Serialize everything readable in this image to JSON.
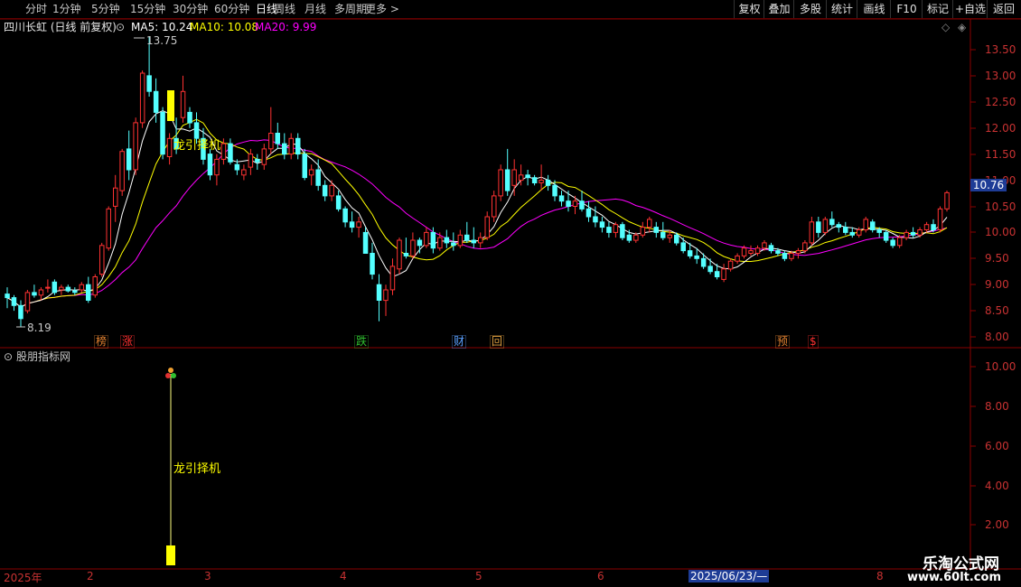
{
  "toolbar": {
    "periods": [
      "分时",
      "1分钟",
      "5分钟",
      "15分钟",
      "30分钟",
      "60分钟",
      "日线",
      "周线",
      "月线",
      "多周期",
      "更多 >"
    ],
    "active_period": "日线",
    "right_buttons": [
      "复权",
      "叠加",
      "多股",
      "统计",
      "画线",
      "F10",
      "标记",
      "+自选",
      "返回"
    ]
  },
  "main": {
    "stock_title": "四川长虹 (日线 前复权)",
    "ma5_label": "MA5: 10.24",
    "ma10_label": "MA10: 10.08",
    "ma20_label": "MA20: 9.99",
    "high_label": "13.75",
    "low_label": "8.19",
    "last_price": "10.76",
    "signal_text": "龙引择机",
    "tags": [
      {
        "text": "榜",
        "color": "#e08030"
      },
      {
        "text": "涨",
        "color": "#ff3030"
      },
      {
        "text": "跌",
        "color": "#30c030"
      },
      {
        "text": "财",
        "color": "#5aa0ff"
      },
      {
        "text": "回",
        "color": "#e0a040"
      },
      {
        "text": "预",
        "color": "#e08030"
      },
      {
        "text": "$",
        "color": "#ff3030"
      }
    ],
    "y_ticks": [
      "13.50",
      "13.00",
      "12.50",
      "12.00",
      "11.50",
      "11.00",
      "10.50",
      "10.00",
      "9.50",
      "9.00",
      "8.50",
      "8.00"
    ]
  },
  "sub": {
    "indicator_title": "股朋指标网",
    "signal_text": "龙引择机",
    "y_ticks": [
      "10.00",
      "8.00",
      "6.00",
      "4.00",
      "2.00"
    ]
  },
  "xaxis": {
    "labels": [
      "2025年",
      "2",
      "3",
      "4",
      "5",
      "6",
      "2025/06/23/—",
      "8"
    ]
  },
  "watermark": {
    "cn": "乐淘公式网",
    "url": "www.60lt.com"
  },
  "colors": {
    "up": "#ff3232",
    "down": "#54ffff",
    "ma5": "#ffffff",
    "ma10": "#ffff00",
    "ma20": "#ff00ff",
    "axis": "#c83232",
    "signal": "#ffff00"
  },
  "chart_data": {
    "type": "candlestick",
    "ma": {
      "MA5": 10.24,
      "MA10": 10.08,
      "MA20": 9.99
    },
    "ylim": [
      7.9,
      13.95
    ],
    "high": 13.75,
    "low": 8.19,
    "last": 10.76,
    "candles": [
      [
        8.82,
        8.95,
        8.55,
        8.75
      ],
      [
        8.75,
        8.8,
        8.5,
        8.6
      ],
      [
        8.6,
        8.7,
        8.19,
        8.35
      ],
      [
        8.5,
        8.9,
        8.45,
        8.85
      ],
      [
        8.85,
        9.0,
        8.75,
        8.8
      ],
      [
        8.8,
        8.95,
        8.7,
        8.9
      ],
      [
        8.95,
        9.1,
        8.85,
        8.95
      ],
      [
        9.05,
        9.1,
        8.8,
        8.85
      ],
      [
        8.9,
        9.0,
        8.8,
        8.95
      ],
      [
        8.95,
        9.0,
        8.85,
        8.88
      ],
      [
        8.88,
        8.95,
        8.8,
        8.85
      ],
      [
        8.9,
        9.05,
        8.85,
        9.0
      ],
      [
        9.0,
        9.15,
        8.65,
        8.7
      ],
      [
        8.8,
        9.2,
        8.75,
        9.15
      ],
      [
        9.2,
        9.8,
        9.15,
        9.75
      ],
      [
        9.7,
        10.5,
        9.65,
        10.45
      ],
      [
        10.5,
        11.1,
        10.2,
        10.85
      ],
      [
        10.8,
        11.6,
        10.7,
        11.55
      ],
      [
        11.6,
        11.95,
        11.0,
        11.2
      ],
      [
        11.2,
        12.2,
        11.1,
        12.1
      ],
      [
        12.1,
        13.1,
        12.0,
        13.05
      ],
      [
        13.0,
        13.75,
        12.6,
        12.7
      ],
      [
        12.7,
        12.95,
        12.1,
        12.3
      ],
      [
        12.3,
        12.4,
        11.4,
        11.5
      ],
      [
        11.45,
        11.9,
        11.3,
        11.8
      ],
      [
        11.8,
        12.2,
        11.5,
        11.6
      ],
      [
        12.2,
        13.0,
        12.1,
        12.7
      ],
      [
        12.3,
        12.4,
        12.0,
        12.1
      ],
      [
        12.1,
        12.3,
        11.7,
        11.8
      ],
      [
        11.8,
        12.0,
        11.3,
        11.4
      ],
      [
        11.5,
        11.6,
        11.0,
        11.1
      ],
      [
        11.1,
        11.5,
        10.9,
        11.4
      ],
      [
        11.4,
        11.8,
        11.3,
        11.7
      ],
      [
        11.7,
        11.8,
        11.3,
        11.35
      ],
      [
        11.3,
        11.4,
        11.1,
        11.2
      ],
      [
        11.1,
        11.3,
        11.0,
        11.2
      ],
      [
        11.25,
        11.6,
        11.1,
        11.5
      ],
      [
        11.4,
        11.5,
        11.2,
        11.35
      ],
      [
        11.3,
        11.7,
        11.2,
        11.6
      ],
      [
        11.6,
        12.4,
        11.5,
        11.9
      ],
      [
        11.9,
        12.1,
        11.6,
        11.7
      ],
      [
        11.7,
        11.9,
        11.4,
        11.5
      ],
      [
        11.5,
        11.9,
        11.4,
        11.8
      ],
      [
        11.8,
        11.9,
        11.4,
        11.5
      ],
      [
        11.5,
        11.6,
        11.0,
        11.05
      ],
      [
        11.1,
        11.3,
        10.9,
        11.2
      ],
      [
        11.2,
        11.4,
        10.8,
        10.9
      ],
      [
        10.9,
        11.0,
        10.6,
        10.7
      ],
      [
        10.7,
        11.0,
        10.6,
        10.9
      ],
      [
        10.7,
        10.8,
        10.4,
        10.45
      ],
      [
        10.45,
        10.5,
        10.1,
        10.2
      ],
      [
        10.2,
        10.4,
        10.0,
        10.1
      ],
      [
        10.1,
        10.3,
        9.9,
        10.2
      ],
      [
        10.0,
        10.1,
        9.6,
        9.6
      ],
      [
        9.6,
        9.8,
        9.1,
        9.2
      ],
      [
        9.0,
        9.2,
        8.3,
        8.7
      ],
      [
        8.7,
        9.0,
        8.4,
        8.9
      ],
      [
        8.9,
        9.5,
        8.8,
        9.35
      ],
      [
        9.3,
        9.9,
        9.2,
        9.85
      ],
      [
        9.6,
        9.9,
        9.5,
        9.55
      ],
      [
        9.55,
        10.0,
        9.5,
        9.85
      ],
      [
        9.85,
        9.9,
        9.6,
        9.75
      ],
      [
        9.75,
        10.1,
        9.7,
        10.0
      ],
      [
        10.0,
        10.1,
        9.6,
        9.7
      ],
      [
        9.7,
        10.0,
        9.65,
        9.9
      ],
      [
        9.9,
        10.05,
        9.7,
        9.8
      ],
      [
        9.8,
        10.0,
        9.65,
        9.75
      ],
      [
        9.75,
        10.05,
        9.7,
        9.95
      ],
      [
        9.95,
        10.2,
        9.8,
        9.85
      ],
      [
        9.85,
        10.1,
        9.7,
        9.8
      ],
      [
        9.8,
        10.0,
        9.7,
        9.9
      ],
      [
        9.9,
        10.4,
        9.85,
        10.3
      ],
      [
        10.3,
        10.8,
        10.2,
        10.7
      ],
      [
        10.7,
        11.3,
        10.6,
        11.2
      ],
      [
        11.2,
        11.6,
        10.7,
        10.8
      ],
      [
        10.9,
        11.4,
        10.7,
        11.2
      ],
      [
        11.0,
        11.3,
        10.9,
        11.1
      ],
      [
        11.1,
        11.2,
        10.9,
        11.05
      ],
      [
        11.05,
        11.1,
        10.9,
        10.95
      ],
      [
        10.95,
        11.3,
        10.8,
        11.0
      ],
      [
        11.0,
        11.1,
        10.8,
        10.9
      ],
      [
        10.9,
        11.0,
        10.6,
        10.7
      ],
      [
        10.7,
        10.8,
        10.5,
        10.6
      ],
      [
        10.6,
        10.8,
        10.4,
        10.5
      ],
      [
        10.5,
        10.7,
        10.35,
        10.6
      ],
      [
        10.6,
        10.8,
        10.4,
        10.45
      ],
      [
        10.45,
        10.6,
        10.2,
        10.3
      ],
      [
        10.3,
        10.5,
        10.1,
        10.2
      ],
      [
        10.2,
        10.3,
        10.0,
        10.1
      ],
      [
        10.1,
        10.2,
        9.9,
        10.0
      ],
      [
        10.0,
        10.2,
        9.9,
        10.15
      ],
      [
        10.15,
        10.2,
        9.85,
        9.9
      ],
      [
        9.95,
        10.05,
        9.8,
        9.85
      ],
      [
        9.85,
        10.0,
        9.8,
        9.95
      ],
      [
        9.95,
        10.2,
        9.9,
        10.1
      ],
      [
        10.1,
        10.3,
        10.0,
        10.25
      ],
      [
        10.1,
        10.2,
        9.9,
        10.0
      ],
      [
        10.0,
        10.2,
        9.85,
        9.9
      ],
      [
        9.9,
        10.05,
        9.8,
        9.95
      ],
      [
        9.95,
        10.0,
        9.75,
        9.8
      ],
      [
        9.8,
        9.9,
        9.6,
        9.65
      ],
      [
        9.65,
        9.8,
        9.5,
        9.55
      ],
      [
        9.55,
        9.7,
        9.4,
        9.5
      ],
      [
        9.5,
        9.6,
        9.3,
        9.35
      ],
      [
        9.35,
        9.5,
        9.2,
        9.25
      ],
      [
        9.25,
        9.4,
        9.1,
        9.15
      ],
      [
        9.1,
        9.4,
        9.05,
        9.3
      ],
      [
        9.3,
        9.5,
        9.25,
        9.45
      ],
      [
        9.45,
        9.6,
        9.4,
        9.55
      ],
      [
        9.55,
        9.75,
        9.5,
        9.7
      ],
      [
        9.6,
        9.75,
        9.55,
        9.65
      ],
      [
        9.6,
        9.75,
        9.55,
        9.7
      ],
      [
        9.7,
        9.85,
        9.65,
        9.8
      ],
      [
        9.75,
        9.8,
        9.6,
        9.65
      ],
      [
        9.65,
        9.7,
        9.55,
        9.6
      ],
      [
        9.6,
        9.65,
        9.45,
        9.5
      ],
      [
        9.5,
        9.65,
        9.45,
        9.6
      ],
      [
        9.6,
        9.7,
        9.5,
        9.65
      ],
      [
        9.65,
        9.85,
        9.6,
        9.8
      ],
      [
        9.8,
        10.3,
        9.75,
        10.2
      ],
      [
        10.2,
        10.3,
        9.9,
        10.0
      ],
      [
        10.0,
        10.3,
        9.95,
        10.25
      ],
      [
        10.25,
        10.4,
        10.1,
        10.15
      ],
      [
        10.15,
        10.2,
        10.0,
        10.1
      ],
      [
        10.1,
        10.2,
        9.95,
        10.0
      ],
      [
        10.0,
        10.1,
        9.9,
        9.95
      ],
      [
        9.95,
        10.1,
        9.9,
        10.05
      ],
      [
        10.05,
        10.3,
        10.0,
        10.25
      ],
      [
        10.2,
        10.25,
        10.0,
        10.05
      ],
      [
        10.05,
        10.1,
        9.9,
        10.0
      ],
      [
        10.0,
        10.05,
        9.8,
        9.85
      ],
      [
        9.85,
        9.9,
        9.7,
        9.75
      ],
      [
        9.75,
        9.95,
        9.7,
        9.9
      ],
      [
        9.9,
        10.05,
        9.85,
        10.0
      ],
      [
        10.0,
        10.1,
        9.9,
        9.95
      ],
      [
        9.95,
        10.1,
        9.9,
        10.05
      ],
      [
        10.05,
        10.2,
        10.0,
        10.15
      ],
      [
        10.15,
        10.25,
        10.0,
        10.05
      ],
      [
        10.05,
        10.5,
        10.0,
        10.45
      ],
      [
        10.45,
        10.8,
        10.4,
        10.76
      ]
    ]
  }
}
